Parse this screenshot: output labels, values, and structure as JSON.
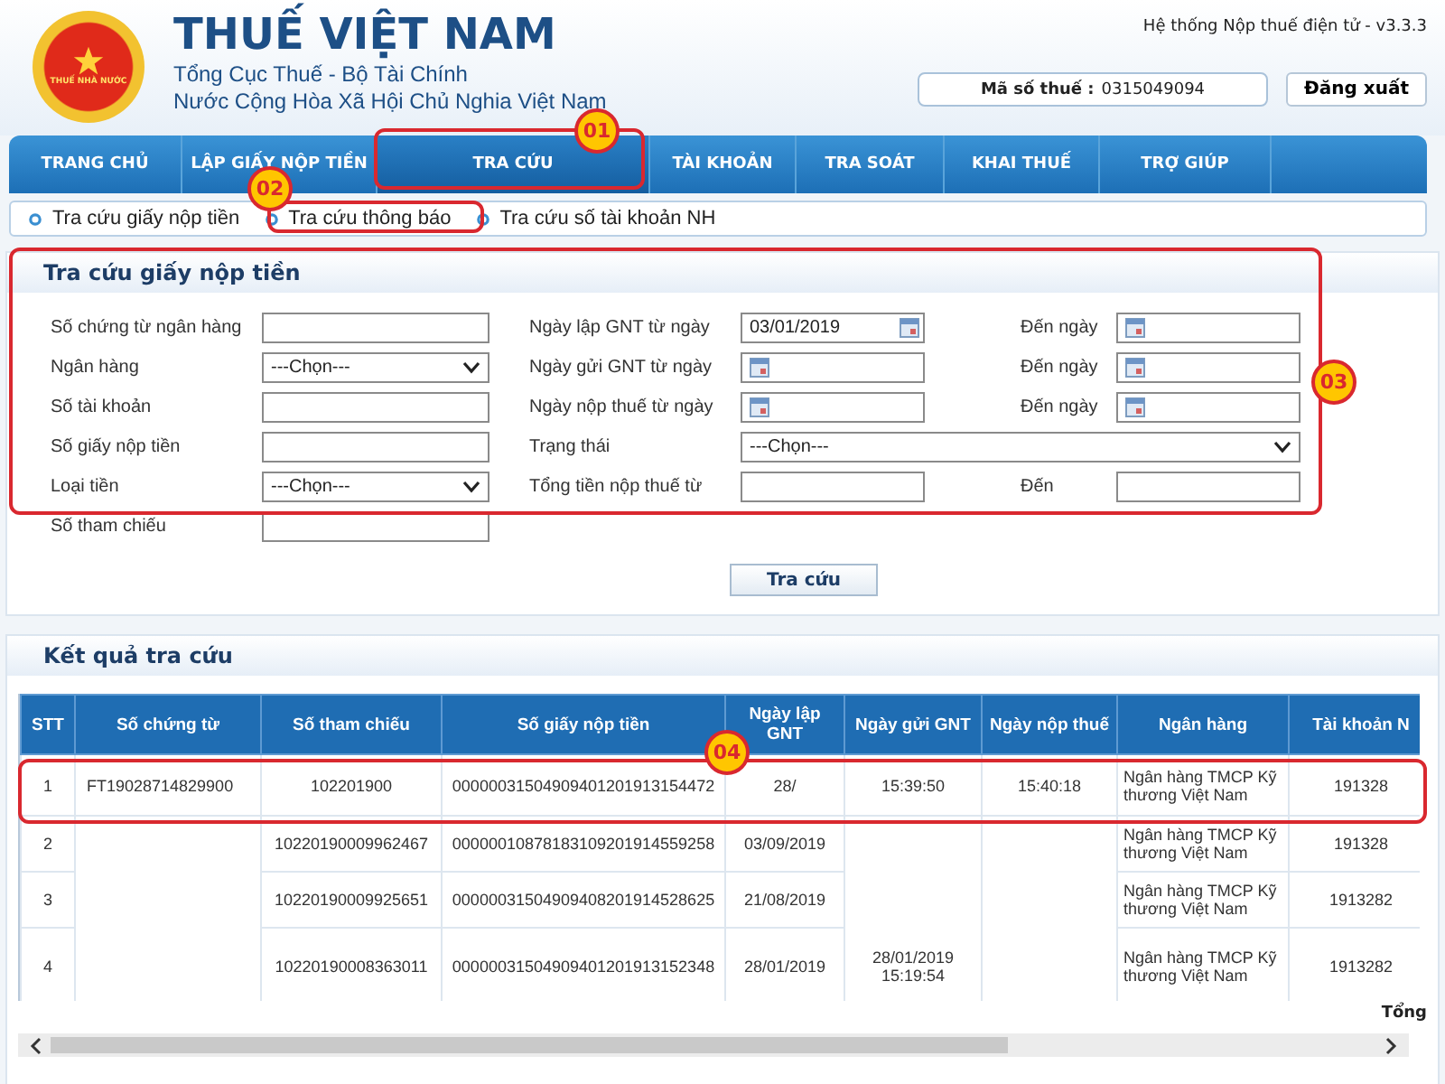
{
  "header": {
    "logo_text": "THUẾ NHÀ NƯỚC",
    "title": "THUẾ VIỆT NAM",
    "subtitle_1": "Tổng Cục Thuế - Bộ Tài Chính",
    "subtitle_2": "Nước Cộng Hòa Xã Hội Chủ Nghia Việt Nam",
    "system_version": "Hệ thống Nộp thuế điện tử - v3.3.3",
    "tax_id_label": "Mã số thuế :",
    "tax_id": "0315049094",
    "logout_button": "Đăng xuất"
  },
  "nav": [
    {
      "label": "TRANG CHỦ",
      "selected": false
    },
    {
      "label": "LẬP GIẤY NỘP TIỀN",
      "selected": false
    },
    {
      "label": "TRA CỨU",
      "selected": true
    },
    {
      "label": "TÀI KHOẢN",
      "selected": false
    },
    {
      "label": "TRA SOÁT",
      "selected": false
    },
    {
      "label": "KHAI THUẾ",
      "selected": false
    },
    {
      "label": "TRỢ GIÚP",
      "selected": false
    }
  ],
  "sub_nav": [
    {
      "label": "Tra cứu giấy nộp tiền",
      "selected": false
    },
    {
      "label": "Tra cứu thông báo",
      "selected": false
    },
    {
      "label": "Tra cứu số tài khoản NH",
      "selected": false
    }
  ],
  "search_panel": {
    "title": "Tra cứu giấy nộp tiền",
    "rows": [
      {
        "fields": [
          {
            "label": "Số chứng từ ngân hàng",
            "kind": "text"
          },
          {
            "label": "Ngày lập GNT từ ngày",
            "kind": "date",
            "value": "03/01/2019"
          },
          {
            "label": "Đến ngày",
            "kind": "date"
          }
        ]
      },
      {
        "fields": [
          {
            "label": "Ngân hàng",
            "kind": "select",
            "value": "---Chọn---"
          },
          {
            "label": "Ngày gửi GNT từ ngày",
            "kind": "date"
          },
          {
            "label": "Đến ngày",
            "kind": "date"
          }
        ]
      },
      {
        "fields": [
          {
            "label": "Số tài khoản",
            "kind": "text"
          },
          {
            "label": "Ngày nộp thuế từ ngày",
            "kind": "date"
          },
          {
            "label": "Đến ngày",
            "kind": "date"
          }
        ]
      },
      {
        "fields": [
          {
            "label": "Số giấy nộp tiền",
            "kind": "text"
          },
          {
            "label": "Trạng thái",
            "kind": "select",
            "value": "---Chọn---"
          }
        ]
      },
      {
        "fields": [
          {
            "label": "Loại tiền",
            "kind": "select",
            "value": "---Chọn---"
          },
          {
            "label": "Tổng tiền nộp thuế từ",
            "kind": "text"
          },
          {
            "label": "Đến",
            "kind": "text"
          }
        ]
      },
      {
        "fields": [
          {
            "label": "Số tham chiếu",
            "kind": "text"
          }
        ]
      }
    ],
    "search_button": "Tra cứu"
  },
  "results": {
    "title": "Kết quả tra cứu",
    "columns": [
      "STT",
      "Số chứng từ",
      "Số tham chiếu",
      "Số giấy nộp tiền",
      "Ngày lập GNT",
      "Ngày gửi GNT",
      "Ngày nộp thuế",
      "Ngân hàng",
      "Tài khoản N"
    ],
    "rows": [
      {
        "cells": [
          "1",
          "FT19028714829900",
          "102201900",
          "00000031504909401201913154472",
          "28/",
          "15:39:50",
          "15:40:18",
          "Ngân hàng TMCP Kỹ thương Việt Nam",
          "191328"
        ]
      },
      {
        "cells": [
          "2",
          null,
          "10220190009962467",
          "00000010878183109201914559258",
          "03/09/2019",
          null,
          null,
          "Ngân hàng TMCP Kỹ thương Việt Nam",
          "191328"
        ]
      },
      {
        "cells": [
          "3",
          null,
          "10220190009925651",
          "00000031504909408201914528625",
          "21/08/2019",
          null,
          null,
          "Ngân hàng TMCP Kỹ thương Việt Nam",
          "1913282"
        ]
      },
      {
        "cells": [
          "4",
          null,
          "10220190008363011",
          "00000031504909401201913152348",
          "28/01/2019",
          "28/01/2019 15:19:54",
          null,
          "Ngân hàng TMCP Kỹ thương Việt Nam",
          "1913282"
        ]
      }
    ],
    "footer_text": "Tổng"
  },
  "annotations": [
    {
      "label": "01"
    },
    {
      "label": "02"
    },
    {
      "label": "03"
    },
    {
      "label": "04"
    }
  ]
}
